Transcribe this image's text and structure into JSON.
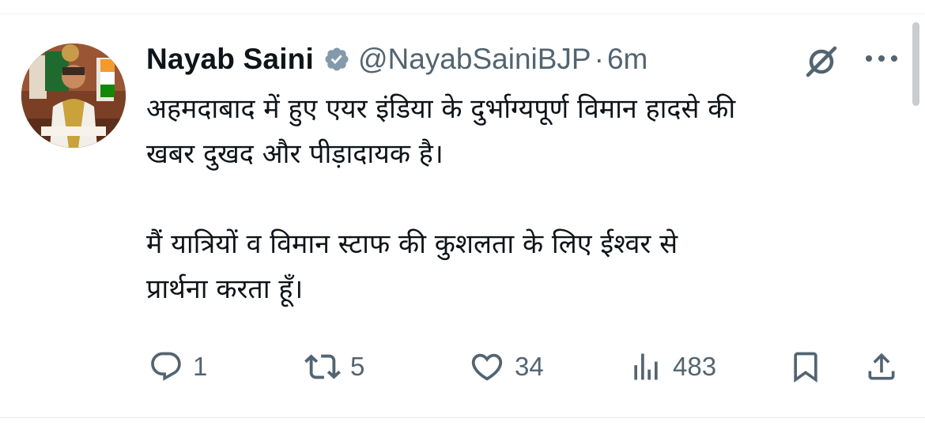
{
  "tweet": {
    "author_name": "Nayab Saini",
    "handle": "@NayabSainiBJP",
    "separator": "·",
    "time": "6m",
    "text": "अहमदाबाद में हुए एयर इंडिया के दुर्भाग्यपूर्ण विमान हादसे की\nखबर दुखद और पीड़ादायक है।\n\nमैं यात्रियों व विमान स्टाफ की कुशलता के लिए ईश्वर से\nप्रार्थना करता हूँ।"
  },
  "actions": {
    "replies": "1",
    "reposts": "5",
    "likes": "34",
    "views": "483"
  },
  "icons": {
    "verified": "verified-badge-icon",
    "grok": "grok-icon",
    "more": "more-icon",
    "reply": "reply-icon",
    "repost": "repost-icon",
    "like": "heart-icon",
    "views": "views-icon",
    "bookmark": "bookmark-icon",
    "share": "share-icon"
  },
  "colors": {
    "text": "#0f1419",
    "secondary": "#536471",
    "verified_badge": "#829aab",
    "divider": "#eff3f4"
  }
}
